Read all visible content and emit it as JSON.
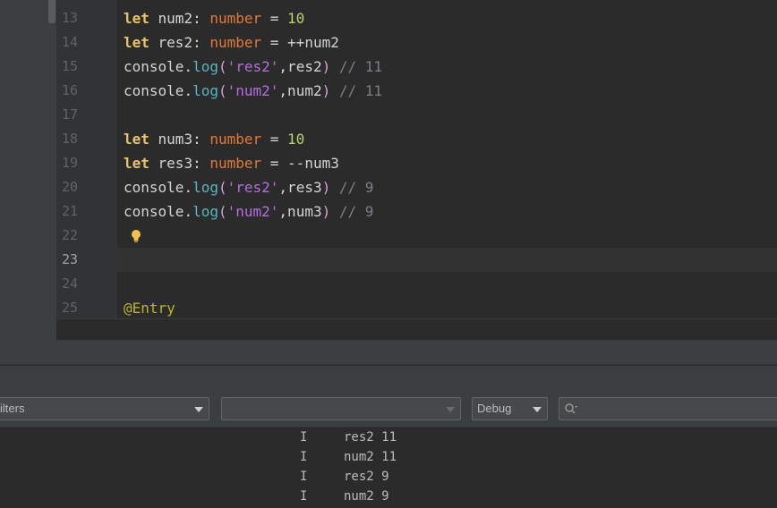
{
  "editor": {
    "lines": [
      {
        "num": "13"
      },
      {
        "num": "14"
      },
      {
        "num": "15"
      },
      {
        "num": "16"
      },
      {
        "num": "17"
      },
      {
        "num": "18"
      },
      {
        "num": "19"
      },
      {
        "num": "20"
      },
      {
        "num": "21"
      },
      {
        "num": "22"
      },
      {
        "num": "23"
      },
      {
        "num": "24"
      },
      {
        "num": "25"
      }
    ],
    "current_line": "23",
    "code": {
      "l13": {
        "kw": "let",
        "name": " num2",
        "colon": ": ",
        "type": "number",
        "eq": " = ",
        "val": "10"
      },
      "l14": {
        "kw": "let",
        "name": " res2",
        "colon": ": ",
        "type": "number",
        "eq": " = ",
        "expr": "++num2"
      },
      "l15": {
        "obj": "console",
        "dot": ".",
        "fn": "log",
        "open": "(",
        "str": "'res2'",
        "arg": ",res2",
        "close": ")",
        "comment": " // 11"
      },
      "l16": {
        "obj": "console",
        "dot": ".",
        "fn": "log",
        "open": "(",
        "str": "'num2'",
        "arg": ",num2",
        "close": ")",
        "comment": " // 11"
      },
      "l18": {
        "kw": "let",
        "name": " num3",
        "colon": ": ",
        "type": "number",
        "eq": " = ",
        "val": "10"
      },
      "l19": {
        "kw": "let",
        "name": " res3",
        "colon": ": ",
        "type": "number",
        "eq": " = ",
        "expr": "--num3"
      },
      "l20": {
        "obj": "console",
        "dot": ".",
        "fn": "log",
        "open": "(",
        "str": "'res2'",
        "arg": ",res3",
        "close": ")",
        "comment": " // 9"
      },
      "l21": {
        "obj": "console",
        "dot": ".",
        "fn": "log",
        "open": "(",
        "str": "'num2'",
        "arg": ",num3",
        "close": ")",
        "comment": " // 9"
      },
      "l25": {
        "decorator": "@Entry"
      }
    },
    "intention_icon": "lightbulb-icon"
  },
  "log_toolbar": {
    "filters_label": "ilters",
    "empty_combo_value": "",
    "level_value": "Debug",
    "search_value": "",
    "search_icon": "search-icon"
  },
  "log": {
    "rows": [
      {
        "level": "I",
        "message": "res2 11"
      },
      {
        "level": "I",
        "message": "num2 11"
      },
      {
        "level": "I",
        "message": "res2 9"
      },
      {
        "level": "I",
        "message": "num2 9"
      }
    ]
  },
  "colors": {
    "keyword": "#e8c46a",
    "type": "#e07a3c",
    "number": "#b8d46c",
    "function": "#56b6c2",
    "string": "#b46ee0",
    "comment": "#7a7e85",
    "decorator": "#bbb529",
    "bulb": "#f2c14e"
  }
}
